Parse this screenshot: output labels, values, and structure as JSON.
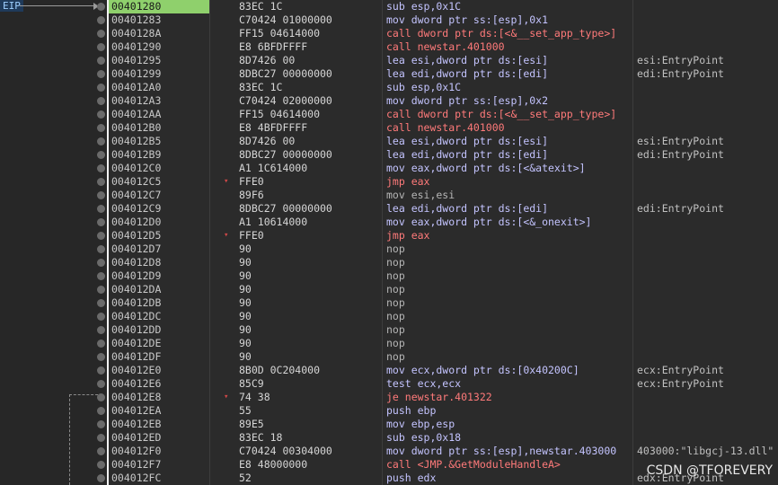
{
  "eip_label": "EIP",
  "rows": [
    {
      "addr": "00401280",
      "bytes": "83EC 1C",
      "asm": "sub esp,0x1C",
      "cmt": "",
      "kind": "sub"
    },
    {
      "addr": "00401283",
      "bytes": "C70424 01000000",
      "asm": "mov dword ptr ss:[esp],0x1",
      "cmt": "",
      "kind": "mov"
    },
    {
      "addr": "0040128A",
      "bytes": "FF15 04614000",
      "asm": "call dword ptr ds:[<&__set_app_type>]",
      "cmt": "",
      "kind": "call"
    },
    {
      "addr": "00401290",
      "bytes": "E8 6BFDFFFF",
      "asm": "call newstar.401000",
      "cmt": "",
      "kind": "call"
    },
    {
      "addr": "00401295",
      "bytes": "8D7426 00",
      "asm": "lea esi,dword ptr ds:[esi]",
      "cmt": "esi:EntryPoint",
      "kind": "mov"
    },
    {
      "addr": "00401299",
      "bytes": "8DBC27 00000000",
      "asm": "lea edi,dword ptr ds:[edi]",
      "cmt": "edi:EntryPoint",
      "kind": "mov"
    },
    {
      "addr": "004012A0",
      "bytes": "83EC 1C",
      "asm": "sub esp,0x1C",
      "cmt": "",
      "kind": "sub"
    },
    {
      "addr": "004012A3",
      "bytes": "C70424 02000000",
      "asm": "mov dword ptr ss:[esp],0x2",
      "cmt": "",
      "kind": "mov"
    },
    {
      "addr": "004012AA",
      "bytes": "FF15 04614000",
      "asm": "call dword ptr ds:[<&__set_app_type>]",
      "cmt": "",
      "kind": "call"
    },
    {
      "addr": "004012B0",
      "bytes": "E8 4BFDFFFF",
      "asm": "call newstar.401000",
      "cmt": "",
      "kind": "call"
    },
    {
      "addr": "004012B5",
      "bytes": "8D7426 00",
      "asm": "lea esi,dword ptr ds:[esi]",
      "cmt": "esi:EntryPoint",
      "kind": "mov"
    },
    {
      "addr": "004012B9",
      "bytes": "8DBC27 00000000",
      "asm": "lea edi,dword ptr ds:[edi]",
      "cmt": "edi:EntryPoint",
      "kind": "mov"
    },
    {
      "addr": "004012C0",
      "bytes": "A1 1C614000",
      "asm": "mov eax,dword ptr ds:[<&atexit>]",
      "cmt": "",
      "kind": "mov"
    },
    {
      "addr": "004012C5",
      "bytes": "FFE0",
      "asm": "jmp eax",
      "cmt": "",
      "kind": "jmp",
      "jmark": true
    },
    {
      "addr": "004012C7",
      "bytes": "89F6",
      "asm": "mov esi,esi",
      "cmt": "",
      "kind": "nop"
    },
    {
      "addr": "004012C9",
      "bytes": "8DBC27 00000000",
      "asm": "lea edi,dword ptr ds:[edi]",
      "cmt": "edi:EntryPoint",
      "kind": "mov"
    },
    {
      "addr": "004012D0",
      "bytes": "A1 10614000",
      "asm": "mov eax,dword ptr ds:[<&_onexit>]",
      "cmt": "",
      "kind": "mov"
    },
    {
      "addr": "004012D5",
      "bytes": "FFE0",
      "asm": "jmp eax",
      "cmt": "",
      "kind": "jmp",
      "jmark": true
    },
    {
      "addr": "004012D7",
      "bytes": "90",
      "asm": "nop",
      "cmt": "",
      "kind": "nop"
    },
    {
      "addr": "004012D8",
      "bytes": "90",
      "asm": "nop",
      "cmt": "",
      "kind": "nop"
    },
    {
      "addr": "004012D9",
      "bytes": "90",
      "asm": "nop",
      "cmt": "",
      "kind": "nop"
    },
    {
      "addr": "004012DA",
      "bytes": "90",
      "asm": "nop",
      "cmt": "",
      "kind": "nop"
    },
    {
      "addr": "004012DB",
      "bytes": "90",
      "asm": "nop",
      "cmt": "",
      "kind": "nop"
    },
    {
      "addr": "004012DC",
      "bytes": "90",
      "asm": "nop",
      "cmt": "",
      "kind": "nop"
    },
    {
      "addr": "004012DD",
      "bytes": "90",
      "asm": "nop",
      "cmt": "",
      "kind": "nop"
    },
    {
      "addr": "004012DE",
      "bytes": "90",
      "asm": "nop",
      "cmt": "",
      "kind": "nop"
    },
    {
      "addr": "004012DF",
      "bytes": "90",
      "asm": "nop",
      "cmt": "",
      "kind": "nop"
    },
    {
      "addr": "004012E0",
      "bytes": "8B0D 0C204000",
      "asm": "mov ecx,dword ptr ds:[0x40200C]",
      "cmt": "ecx:EntryPoint",
      "kind": "mov"
    },
    {
      "addr": "004012E6",
      "bytes": "85C9",
      "asm": "test ecx,ecx",
      "cmt": "ecx:EntryPoint",
      "kind": "mov"
    },
    {
      "addr": "004012E8",
      "bytes": "74 38",
      "asm": "je newstar.401322",
      "cmt": "",
      "kind": "jmp",
      "jmark": true
    },
    {
      "addr": "004012EA",
      "bytes": "55",
      "asm": "push ebp",
      "cmt": "",
      "kind": "mov"
    },
    {
      "addr": "004012EB",
      "bytes": "89E5",
      "asm": "mov ebp,esp",
      "cmt": "",
      "kind": "mov"
    },
    {
      "addr": "004012ED",
      "bytes": "83EC 18",
      "asm": "sub esp,0x18",
      "cmt": "",
      "kind": "sub"
    },
    {
      "addr": "004012F0",
      "bytes": "C70424 00304000",
      "asm": "mov dword ptr ss:[esp],newstar.403000",
      "cmt": "403000:\"libgcj-13.dll\"",
      "kind": "mov"
    },
    {
      "addr": "004012F7",
      "bytes": "E8 48000000",
      "asm": "call <JMP.&GetModuleHandleA>",
      "cmt": "",
      "kind": "call"
    },
    {
      "addr": "004012FC",
      "bytes": "52",
      "asm": "push edx",
      "cmt": "edx:EntryPoint",
      "kind": "mov"
    }
  ],
  "watermark": "CSDN @TFOREVERY",
  "colors": {
    "eip_highlight": "#8fd06c",
    "call": "#ff7a7a",
    "jump": "#ff7a7a",
    "mov": "#c4c4ff",
    "nop": "#b5b5b5"
  }
}
